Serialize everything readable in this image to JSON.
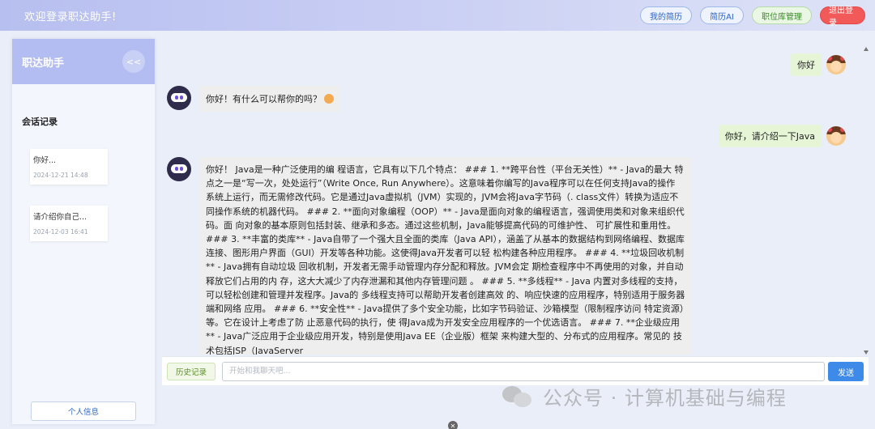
{
  "topbar": {
    "welcome": "欢迎登录职达助手!",
    "resume_btn": "我的简历",
    "resume_ai_btn": "简历AI",
    "jobs_btn": "职位库管理",
    "logout_btn": "退出登录"
  },
  "sidebar": {
    "brand": "职达助手",
    "collapse": "<<",
    "sessions_title": "会话记录",
    "sessions": [
      {
        "title": "你好...",
        "time": "2024-12-21 14:48"
      },
      {
        "title": "请介绍你自己...",
        "time": "2024-12-03 16:41"
      }
    ],
    "profile_btn": "个人信息"
  },
  "chat": {
    "messages": [
      {
        "role": "user",
        "text": "你好"
      },
      {
        "role": "bot",
        "text": "你好！有什么可以帮你的吗？"
      },
      {
        "role": "user",
        "text": "你好，请介绍一下Java"
      },
      {
        "role": "bot",
        "text": "你好！ Java是一种广泛使用的编 程语言，它具有以下几个特点： ### 1. **跨平台性（平台无关性）** - Java的最大 特点之一是“写一次，处处运行”（Write Once, Run Anywhere）。这意味着你编写的Java程序可以在任何支持Java的操作 系统上运行，而无需修改代码。它是通过Java虚拟机（JVM）实现的，JVM会将Java字节码（. class文件）转换为适应不同操作系统的机器代码。 ### 2. **面向对象编程（OOP）** - Java是面向对象的编程语言，强调使用类和对象来组织代码。面 向对象的基本原则包括封装、继承和多态。通过这些机制，Java能够提高代码的可维护性、 可扩展性和重用性。 ### 3. **丰富的类库** - Java自带了一个强大且全面的类库（Java API），涵盖了从基本的数据结构到网络编程、数据库连接、图形用户界面（GUI）开发等各种功能。这使得Java开发者可以轻 松构建各种应用程序。 ### 4. **垃圾回收机制** - Java拥有自动垃圾 回收机制，开发者无需手动管理内存分配和释放。JVM会定 期检查程序中不再使用的对象，并自动释放它们占用的内 存，这大大减少了内存泄漏和其他内存管理问题 。 ### 5. **多线程** - Java 内置对多线程的支持，可以轻松创建和管理并发程序。Java的 多线程支持可以帮助开发者创建高效 的、响应快速的应用程序，特别适用于服务器端和网络 应用。 ### 6. **安全性** - Java提供了多个安全功能，比如字节码验证、沙箱模型（限制程序访问 特定资源）等。它在设计上考虑了防 止恶意代码的执行，使 得Java成为开发安全应用程序的一个优选语言。 ### 7. **企业级应用** - Java广泛应用于企业级应用开发，特别是使用Java EE（企业版）框架 来构建大型的、分布式的应用程序。常见的 技术包括JSP（JavaServer"
      }
    ]
  },
  "input": {
    "history_btn": "历史记录",
    "placeholder": "开始和我聊天吧...",
    "value": "",
    "send_btn": "发送"
  },
  "watermark": "公众号 · 计算机基础与编程",
  "colors": {
    "topbar": "#b7bff0",
    "sidebar_header": "#b3bdf1",
    "user_bubble": "#e5f5d6",
    "bot_bubble": "#eeeeef",
    "send": "#3d8ae8",
    "logout": "#f25a5a"
  }
}
